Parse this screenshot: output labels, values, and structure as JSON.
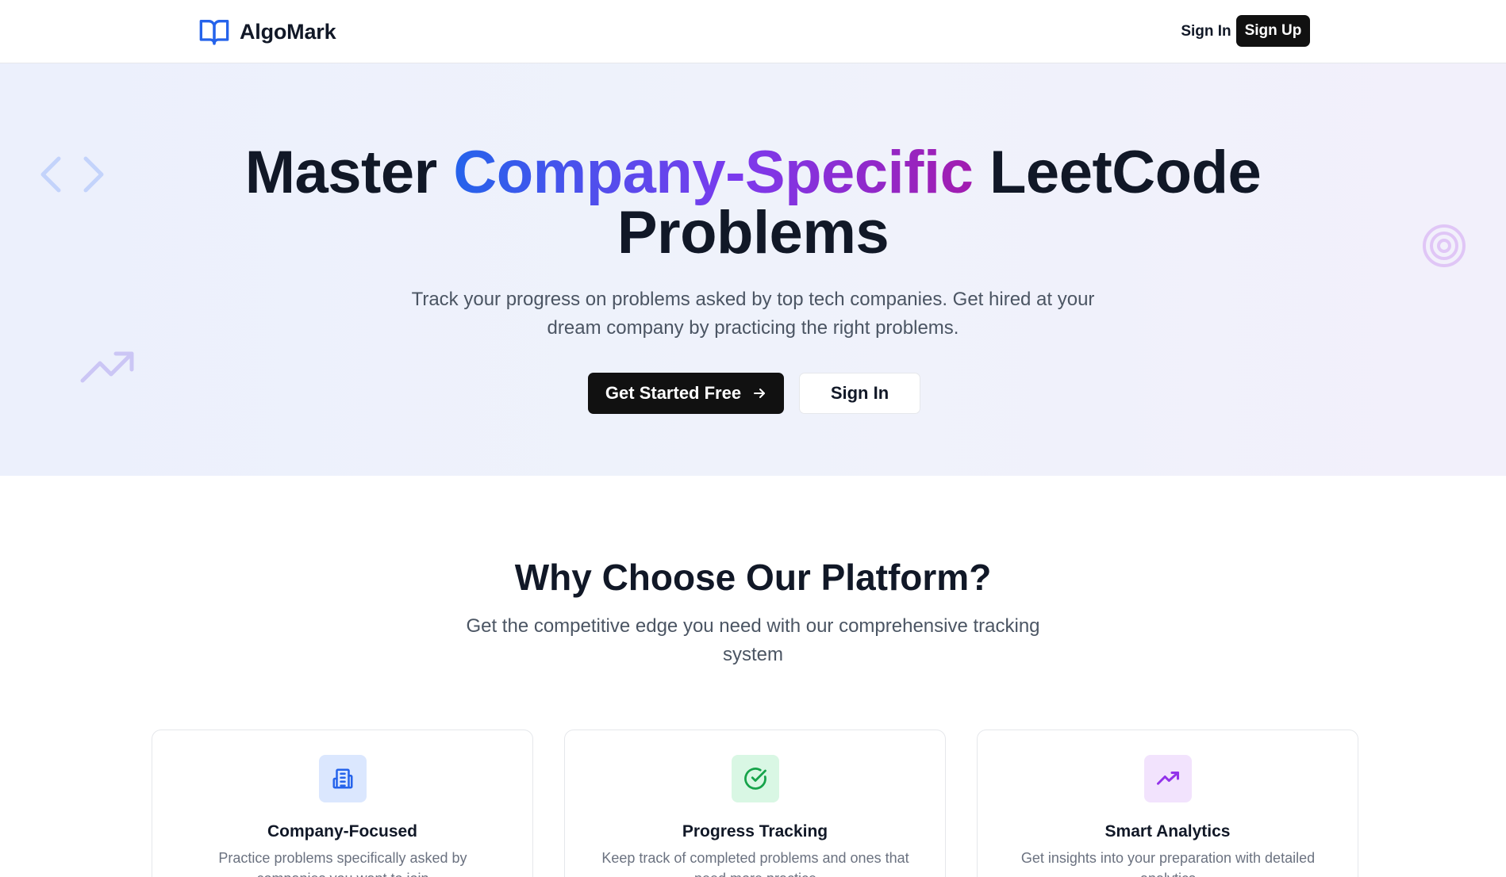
{
  "header": {
    "brand_name": "AlgoMark",
    "logo_icon": "open-book-icon",
    "sign_in_label": "Sign In",
    "sign_up_label": "Sign Up"
  },
  "hero": {
    "title_part1": "Master",
    "title_highlight": "Company-Specific",
    "title_part2": "LeetCode",
    "title_line2": "Problems",
    "subtitle": "Track your progress on problems asked by top tech companies. Get hired at your dream company by practicing the right problems.",
    "primary_cta_label": "Get Started Free",
    "primary_cta_icon": "arrow-right-icon",
    "secondary_cta_label": "Sign In",
    "decorative_icons": [
      "code-brackets-icon",
      "trending-up-icon",
      "target-icon"
    ]
  },
  "features": {
    "title": "Why Choose Our Platform?",
    "subtitle": "Get the competitive edge you need with our comprehensive tracking system",
    "cards": [
      {
        "icon": "building-icon",
        "title": "Company-Focused",
        "description": "Practice problems specifically asked by companies you want to join"
      },
      {
        "icon": "check-circle-icon",
        "title": "Progress Tracking",
        "description": "Keep track of completed problems and ones that need more practice"
      },
      {
        "icon": "trending-up-icon",
        "title": "Smart Analytics",
        "description": "Get insights into your preparation with detailed analytics"
      }
    ]
  },
  "colors": {
    "brand_blue": "#2563eb",
    "gradient_purple": "#a21caf",
    "button_dark": "#111111",
    "hero_background": "#eef1fb",
    "icon_green": "#16a34a",
    "icon_purple": "#9333ea"
  }
}
